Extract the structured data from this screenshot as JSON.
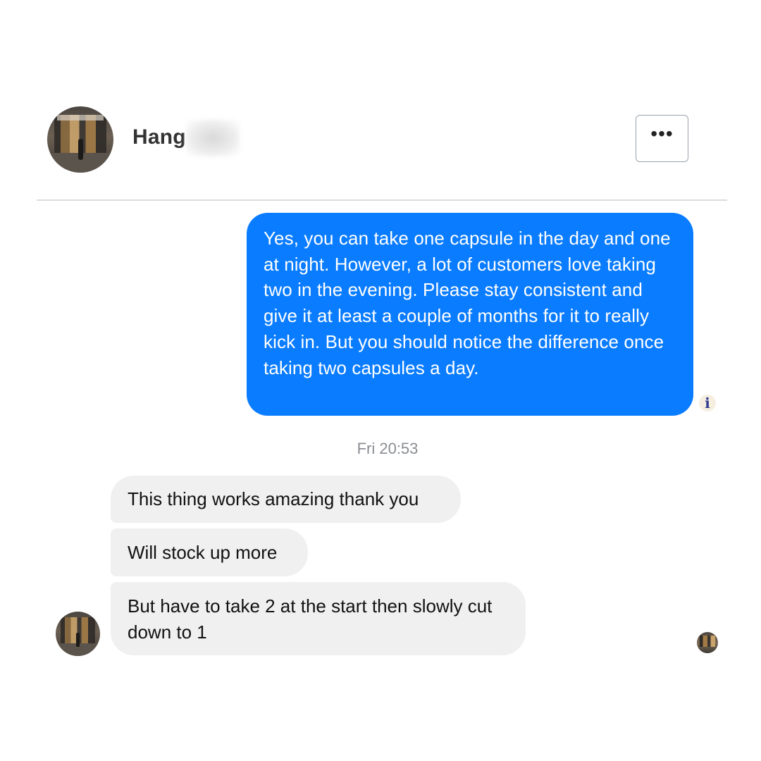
{
  "header": {
    "contact_name": "Hang",
    "more_icon": "more-horizontal-icon",
    "more_label": "•••"
  },
  "messages": {
    "outgoing": [
      {
        "text": "Yes, you can take one capsule in the day and one at night. However, a lot of customers love taking two in the evening. Please stay consistent and give it at least a couple of months for it to really kick in. But you should notice the difference once taking two capsules a day."
      }
    ],
    "timestamp": "Fri 20:53",
    "incoming": [
      {
        "text": "This thing works amazing thank you"
      },
      {
        "text": "Will stock up more"
      },
      {
        "text": "But have to take 2 at the start then slowly cut down to 1"
      }
    ]
  },
  "status": {
    "seen_icon": "seen-indicator-icon",
    "seen_glyph": "ℹ"
  },
  "colors": {
    "outgoing_bubble": "#0a7cff",
    "incoming_bubble": "#f0f0f0",
    "timestamp": "#8a8d91"
  }
}
